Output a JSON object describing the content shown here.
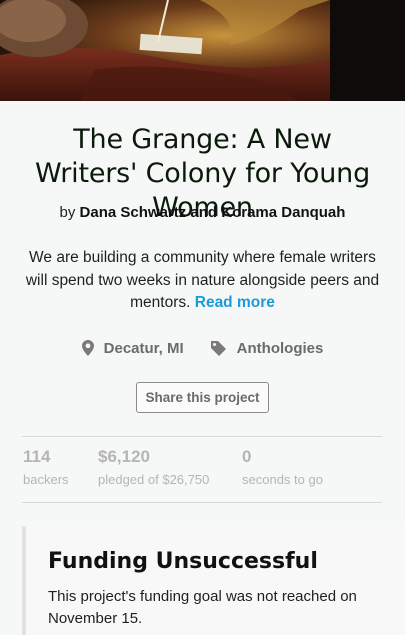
{
  "hero": {
    "image_description_icon": "hero-painting-image"
  },
  "project": {
    "title": "The Grange: A New Writers' Colony for Young Women",
    "by_prefix": "by",
    "authors": "Dana Schwartz and Korama Danquah",
    "blurb": "We are building a community where female writers will spend two weeks in nature alongside peers and mentors.",
    "read_more": "Read more",
    "location": "Decatur, MI",
    "category": "Anthologies",
    "share_label": "Share this project"
  },
  "stats": {
    "backers_value": "114",
    "backers_label": "backers",
    "pledged_value": "$6,120",
    "pledged_label": "pledged of $26,750",
    "time_value": "0",
    "time_label": "seconds to go"
  },
  "notice": {
    "title": "Funding Unsuccessful",
    "text": "This project's funding goal was not reached on November 15."
  },
  "colors": {
    "accent_link": "#1c9bd8",
    "muted_stat": "#b5b5b5",
    "background": "#f5f8f7"
  },
  "icons": {
    "location": "map-pin-icon",
    "category": "tag-icon"
  }
}
